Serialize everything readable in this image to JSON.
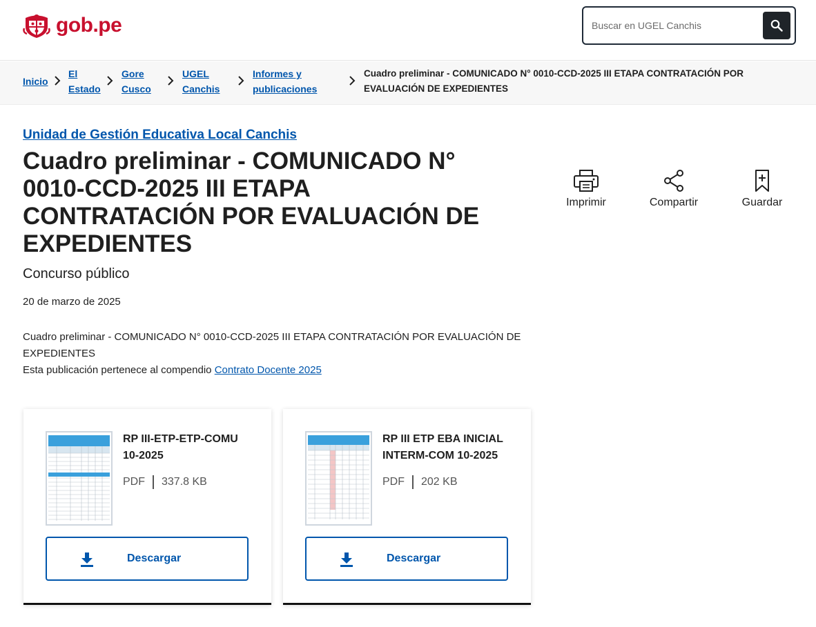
{
  "header": {
    "logo_text": "gob.pe",
    "search_placeholder": "Buscar en UGEL Canchis"
  },
  "breadcrumb": [
    {
      "line1": "Inicio",
      "line2": ""
    },
    {
      "line1": "El",
      "line2": "Estado"
    },
    {
      "line1": "Gore",
      "line2": "Cusco"
    },
    {
      "line1": "UGEL",
      "line2": "Canchis"
    },
    {
      "line1": "Informes y",
      "line2": "publicaciones"
    },
    {
      "line1": "Cuadro preliminar - COMUNICADO N° 0010-CCD-2025 III ETAPA CONTRATACIÓN POR",
      "line2": "EVALUACIÓN DE EXPEDIENTES"
    }
  ],
  "main": {
    "org": "Unidad de Gestión Educativa Local Canchis",
    "title": "Cuadro preliminar - COMUNICADO N° 0010-CCD-2025 III ETAPA CONTRATACIÓN POR EVALUACIÓN DE EXPEDIENTES",
    "subtitle": "Concurso público",
    "date": "20 de marzo de 2025",
    "description": "Cuadro preliminar - COMUNICADO N° 0010-CCD-2025 III ETAPA CONTRATACIÓN POR EVALUACIÓN DE EXPEDIENTES",
    "compendium_prefix": "Esta publicación pertenece al compendio",
    "compendium_link": "Contrato Docente 2025"
  },
  "actions": {
    "print": "Imprimir",
    "share": "Compartir",
    "save": "Guardar"
  },
  "files": [
    {
      "name": "RP III-ETP-ETP-COMU 10-2025",
      "type": "PDF",
      "size": "337.8 KB",
      "download": "Descargar"
    },
    {
      "name": "RP III ETP EBA INICIAL INTERM-COM 10-2025",
      "type": "PDF",
      "size": "202 KB",
      "download": "Descargar"
    }
  ],
  "colors": {
    "brand_red": "#c8102e",
    "link_blue": "#0056ac",
    "dark": "#1f2429"
  },
  "icons": {
    "logo": "peru-shield-icon",
    "search": "search-icon",
    "separator": "chevron-right-icon",
    "print": "printer-icon",
    "share": "share-icon",
    "save": "bookmark-plus-icon",
    "download": "download-icon"
  }
}
